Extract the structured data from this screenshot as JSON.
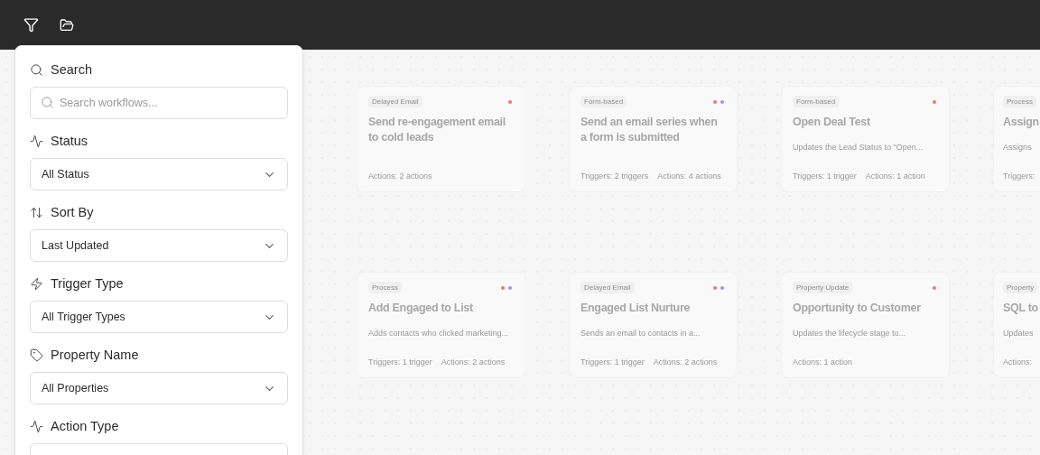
{
  "toolbar": {
    "buttons": [
      {
        "kind": "filter"
      },
      {
        "kind": "folder"
      }
    ]
  },
  "filter_panel": {
    "sections": [
      {
        "kind": "search",
        "label": "Search",
        "placeholder": "Search workflows..."
      },
      {
        "kind": "status",
        "label": "Status",
        "value": "All Status"
      },
      {
        "kind": "sort",
        "label": "Sort By",
        "value": "Last Updated"
      },
      {
        "kind": "trigger",
        "label": "Trigger Type",
        "value": "All Trigger Types"
      },
      {
        "kind": "property",
        "label": "Property Name",
        "value": "All Properties"
      },
      {
        "kind": "action",
        "label": "Action Type"
      }
    ]
  },
  "workflow_rows": [
    [
      {
        "tag": "Delayed Email",
        "title": "Send re-engagement email to cold leads",
        "dots": [
          {
            "color": "#f87171"
          }
        ],
        "actions": "Actions: 2 actions"
      },
      {
        "tag": "Form-based",
        "title": "Send an email series when a form is submitted",
        "dots": [
          {
            "color": "#f87171"
          },
          {
            "color": "#a78bfa"
          }
        ],
        "triggers": "Triggers: 2 triggers",
        "actions": "Actions: 4 actions"
      },
      {
        "tag": "Form-based",
        "title": "Open Deal Test",
        "dots": [
          {
            "color": "#f87171"
          }
        ],
        "description": "Updates the Lead Status to \"Open...",
        "triggers": "Triggers: 1 trigger",
        "actions": "Actions: 1 action"
      },
      {
        "tag": "Process",
        "title": "Assign",
        "description": "Assigns",
        "triggers": "Triggers:"
      }
    ],
    [
      {
        "tag": "Process",
        "title": "Add Engaged to List",
        "dots": [
          {
            "color": "#f87171"
          },
          {
            "color": "#a78bfa"
          }
        ],
        "description": "Adds contacts who clicked marketing...",
        "triggers": "Triggers: 1 trigger",
        "actions": "Actions: 2 actions"
      },
      {
        "tag": "Delayed Email",
        "title": "Engaged List Nurture",
        "dots": [
          {
            "color": "#f87171"
          },
          {
            "color": "#a78bfa"
          }
        ],
        "description": "Sends an email to contacts in a...",
        "triggers": "Triggers: 1 trigger",
        "actions": "Actions: 2 actions"
      },
      {
        "tag": "Property Update",
        "title": "Opportunity to Customer",
        "dots": [
          {
            "color": "#f87171"
          }
        ],
        "description": "Updates the lifecycle stage to...",
        "actions": "Actions: 1 action"
      },
      {
        "tag": "Property",
        "title": "SQL to",
        "description": "Updates",
        "actions": "Actions:"
      }
    ]
  ]
}
